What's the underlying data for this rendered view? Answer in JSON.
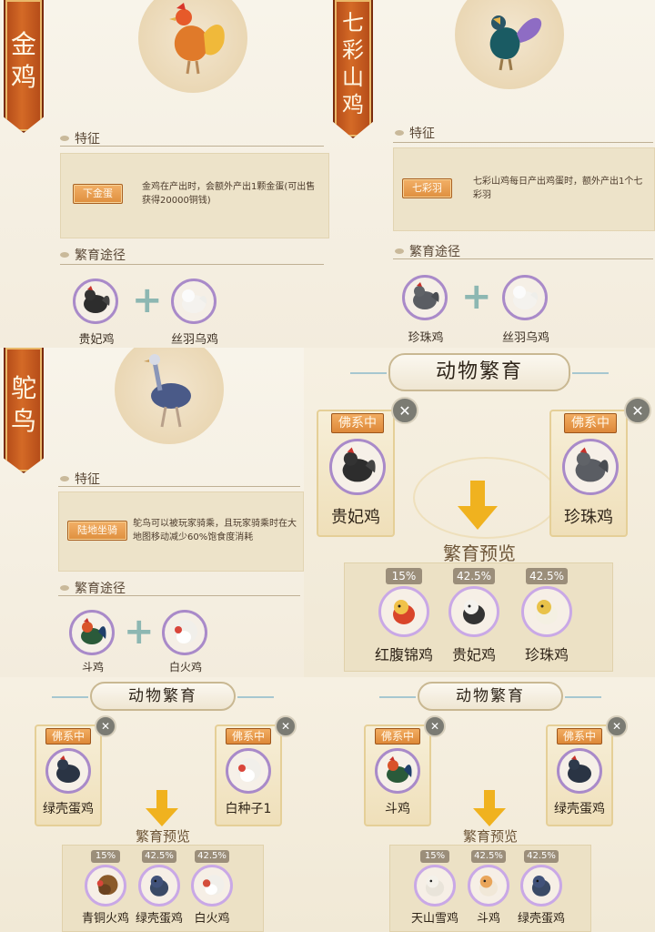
{
  "golden_pheasant": {
    "banner": [
      "金",
      "鸡"
    ],
    "feature_title": "特征",
    "feature_tag": "下金蛋",
    "feature_text": "金鸡在产出时，会额外产出1颗金蛋(可出售获得20000铜钱)",
    "breeding_title": "繁育途径",
    "parents": [
      "贵妃鸡",
      "丝羽乌鸡"
    ]
  },
  "rainbow_pheasant": {
    "banner": [
      "七",
      "彩",
      "山",
      "鸡"
    ],
    "feature_title": "特征",
    "feature_tag": "七彩羽",
    "feature_text": "七彩山鸡每日产出鸡蛋时，额外产出1个七彩羽",
    "breeding_title": "繁育途径",
    "parents": [
      "珍珠鸡",
      "丝羽乌鸡"
    ]
  },
  "ostrich": {
    "banner": [
      "鸵",
      "鸟"
    ],
    "feature_title": "特征",
    "feature_tag": "陆地坐骑",
    "feature_text": "鸵鸟可以被玩家骑乘，且玩家骑乘时在大地图移动减少60%饱食度消耗",
    "breeding_title": "繁育途径",
    "parents": [
      "斗鸡",
      "白火鸡"
    ]
  },
  "breed1": {
    "title": "动物繁育",
    "status": "佛系中",
    "left_name": "贵妃鸡",
    "right_name": "珍珠鸡",
    "preview_title": "繁育预览",
    "children": [
      {
        "pct": "15%",
        "name": "红腹锦鸡",
        "color": "#d9452a"
      },
      {
        "pct": "42.5%",
        "name": "贵妃鸡",
        "color": "#3a3a3a"
      },
      {
        "pct": "42.5%",
        "name": "珍珠鸡",
        "color": "#e9c24a"
      }
    ]
  },
  "breed2": {
    "title": "动物繁育",
    "status": "佛系中",
    "left_name": "绿壳蛋鸡",
    "right_name": "白种子1",
    "preview_title": "繁育预览",
    "children": [
      {
        "pct": "15%",
        "name": "青铜火鸡",
        "color": "#8a5a2a"
      },
      {
        "pct": "42.5%",
        "name": "绿壳蛋鸡",
        "color": "#3a4a66"
      },
      {
        "pct": "42.5%",
        "name": "白火鸡",
        "color": "#d44d3a"
      }
    ]
  },
  "breed3": {
    "title": "动物繁育",
    "status": "佛系中",
    "left_name": "斗鸡",
    "right_name": "绿壳蛋鸡",
    "preview_title": "繁育预览",
    "children": [
      {
        "pct": "15%",
        "name": "天山雪鸡",
        "color": "#cfc9c0"
      },
      {
        "pct": "42.5%",
        "name": "斗鸡",
        "color": "#e9a55a"
      },
      {
        "pct": "42.5%",
        "name": "绿壳蛋鸡",
        "color": "#3a4a66"
      }
    ]
  },
  "colors": {
    "accent_orange": "#de8a3a",
    "frame_purple": "#a98ac9",
    "arrow_yellow": "#f0b21f"
  }
}
